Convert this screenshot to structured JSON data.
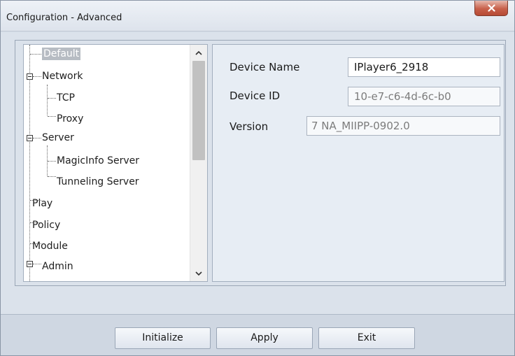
{
  "window": {
    "title": "Configuration - Advanced"
  },
  "tree": {
    "items": [
      {
        "label": "Default",
        "level": 0,
        "selected": true
      },
      {
        "label": "Network",
        "level": 0,
        "expanded": true
      },
      {
        "label": "TCP",
        "level": 1
      },
      {
        "label": "Proxy",
        "level": 1
      },
      {
        "label": "Server",
        "level": 0,
        "expanded": true
      },
      {
        "label": "MagicInfo Server",
        "level": 1
      },
      {
        "label": "Tunneling Server",
        "level": 1
      },
      {
        "label": "Play",
        "level": 0
      },
      {
        "label": "Policy",
        "level": 0
      },
      {
        "label": "Module",
        "level": 0
      },
      {
        "label": "Admin",
        "level": 0,
        "expanded": true
      }
    ]
  },
  "details": {
    "device_name_label": "Device Name",
    "device_name_value": "IPlayer6_2918",
    "device_id_label": "Device ID",
    "device_id_value": "10-e7-c6-4d-6c-b0",
    "version_label": "Version",
    "version_value": "7 NA_MIIPP-0902.0"
  },
  "buttons": {
    "initialize": "Initialize",
    "apply": "Apply",
    "exit": "Exit"
  },
  "icons": {
    "close": "close-icon",
    "scroll_up": "chevron-up-icon",
    "scroll_down": "chevron-down-icon",
    "expander": "collapse-icon"
  },
  "colors": {
    "close_button": "#c8604a",
    "selection": "#b7bcc3",
    "background": "#dbe2eb"
  }
}
